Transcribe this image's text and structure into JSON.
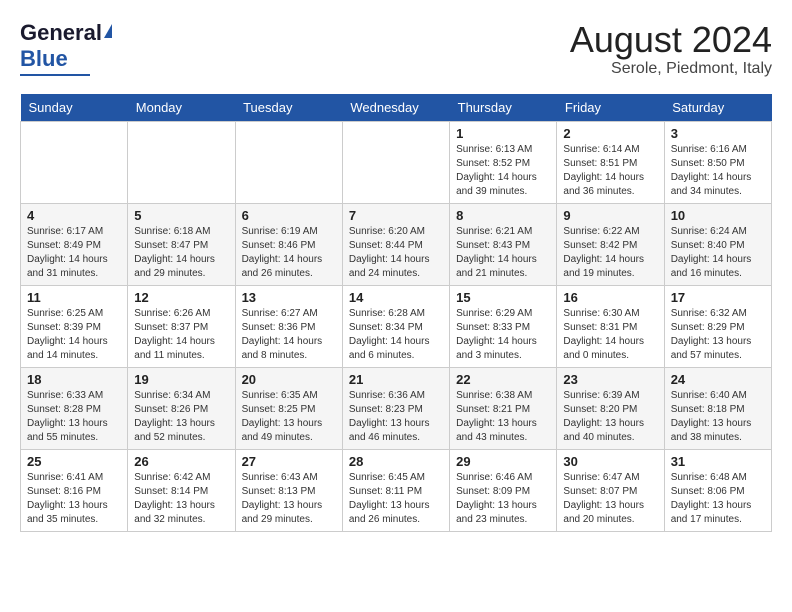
{
  "header": {
    "logo_general": "General",
    "logo_blue": "Blue",
    "month_year": "August 2024",
    "location": "Serole, Piedmont, Italy"
  },
  "weekdays": [
    "Sunday",
    "Monday",
    "Tuesday",
    "Wednesday",
    "Thursday",
    "Friday",
    "Saturday"
  ],
  "weeks": [
    [
      {
        "day": "",
        "info": ""
      },
      {
        "day": "",
        "info": ""
      },
      {
        "day": "",
        "info": ""
      },
      {
        "day": "",
        "info": ""
      },
      {
        "day": "1",
        "info": "Sunrise: 6:13 AM\nSunset: 8:52 PM\nDaylight: 14 hours\nand 39 minutes."
      },
      {
        "day": "2",
        "info": "Sunrise: 6:14 AM\nSunset: 8:51 PM\nDaylight: 14 hours\nand 36 minutes."
      },
      {
        "day": "3",
        "info": "Sunrise: 6:16 AM\nSunset: 8:50 PM\nDaylight: 14 hours\nand 34 minutes."
      }
    ],
    [
      {
        "day": "4",
        "info": "Sunrise: 6:17 AM\nSunset: 8:49 PM\nDaylight: 14 hours\nand 31 minutes."
      },
      {
        "day": "5",
        "info": "Sunrise: 6:18 AM\nSunset: 8:47 PM\nDaylight: 14 hours\nand 29 minutes."
      },
      {
        "day": "6",
        "info": "Sunrise: 6:19 AM\nSunset: 8:46 PM\nDaylight: 14 hours\nand 26 minutes."
      },
      {
        "day": "7",
        "info": "Sunrise: 6:20 AM\nSunset: 8:44 PM\nDaylight: 14 hours\nand 24 minutes."
      },
      {
        "day": "8",
        "info": "Sunrise: 6:21 AM\nSunset: 8:43 PM\nDaylight: 14 hours\nand 21 minutes."
      },
      {
        "day": "9",
        "info": "Sunrise: 6:22 AM\nSunset: 8:42 PM\nDaylight: 14 hours\nand 19 minutes."
      },
      {
        "day": "10",
        "info": "Sunrise: 6:24 AM\nSunset: 8:40 PM\nDaylight: 14 hours\nand 16 minutes."
      }
    ],
    [
      {
        "day": "11",
        "info": "Sunrise: 6:25 AM\nSunset: 8:39 PM\nDaylight: 14 hours\nand 14 minutes."
      },
      {
        "day": "12",
        "info": "Sunrise: 6:26 AM\nSunset: 8:37 PM\nDaylight: 14 hours\nand 11 minutes."
      },
      {
        "day": "13",
        "info": "Sunrise: 6:27 AM\nSunset: 8:36 PM\nDaylight: 14 hours\nand 8 minutes."
      },
      {
        "day": "14",
        "info": "Sunrise: 6:28 AM\nSunset: 8:34 PM\nDaylight: 14 hours\nand 6 minutes."
      },
      {
        "day": "15",
        "info": "Sunrise: 6:29 AM\nSunset: 8:33 PM\nDaylight: 14 hours\nand 3 minutes."
      },
      {
        "day": "16",
        "info": "Sunrise: 6:30 AM\nSunset: 8:31 PM\nDaylight: 14 hours\nand 0 minutes."
      },
      {
        "day": "17",
        "info": "Sunrise: 6:32 AM\nSunset: 8:29 PM\nDaylight: 13 hours\nand 57 minutes."
      }
    ],
    [
      {
        "day": "18",
        "info": "Sunrise: 6:33 AM\nSunset: 8:28 PM\nDaylight: 13 hours\nand 55 minutes."
      },
      {
        "day": "19",
        "info": "Sunrise: 6:34 AM\nSunset: 8:26 PM\nDaylight: 13 hours\nand 52 minutes."
      },
      {
        "day": "20",
        "info": "Sunrise: 6:35 AM\nSunset: 8:25 PM\nDaylight: 13 hours\nand 49 minutes."
      },
      {
        "day": "21",
        "info": "Sunrise: 6:36 AM\nSunset: 8:23 PM\nDaylight: 13 hours\nand 46 minutes."
      },
      {
        "day": "22",
        "info": "Sunrise: 6:38 AM\nSunset: 8:21 PM\nDaylight: 13 hours\nand 43 minutes."
      },
      {
        "day": "23",
        "info": "Sunrise: 6:39 AM\nSunset: 8:20 PM\nDaylight: 13 hours\nand 40 minutes."
      },
      {
        "day": "24",
        "info": "Sunrise: 6:40 AM\nSunset: 8:18 PM\nDaylight: 13 hours\nand 38 minutes."
      }
    ],
    [
      {
        "day": "25",
        "info": "Sunrise: 6:41 AM\nSunset: 8:16 PM\nDaylight: 13 hours\nand 35 minutes."
      },
      {
        "day": "26",
        "info": "Sunrise: 6:42 AM\nSunset: 8:14 PM\nDaylight: 13 hours\nand 32 minutes."
      },
      {
        "day": "27",
        "info": "Sunrise: 6:43 AM\nSunset: 8:13 PM\nDaylight: 13 hours\nand 29 minutes."
      },
      {
        "day": "28",
        "info": "Sunrise: 6:45 AM\nSunset: 8:11 PM\nDaylight: 13 hours\nand 26 minutes."
      },
      {
        "day": "29",
        "info": "Sunrise: 6:46 AM\nSunset: 8:09 PM\nDaylight: 13 hours\nand 23 minutes."
      },
      {
        "day": "30",
        "info": "Sunrise: 6:47 AM\nSunset: 8:07 PM\nDaylight: 13 hours\nand 20 minutes."
      },
      {
        "day": "31",
        "info": "Sunrise: 6:48 AM\nSunset: 8:06 PM\nDaylight: 13 hours\nand 17 minutes."
      }
    ]
  ]
}
